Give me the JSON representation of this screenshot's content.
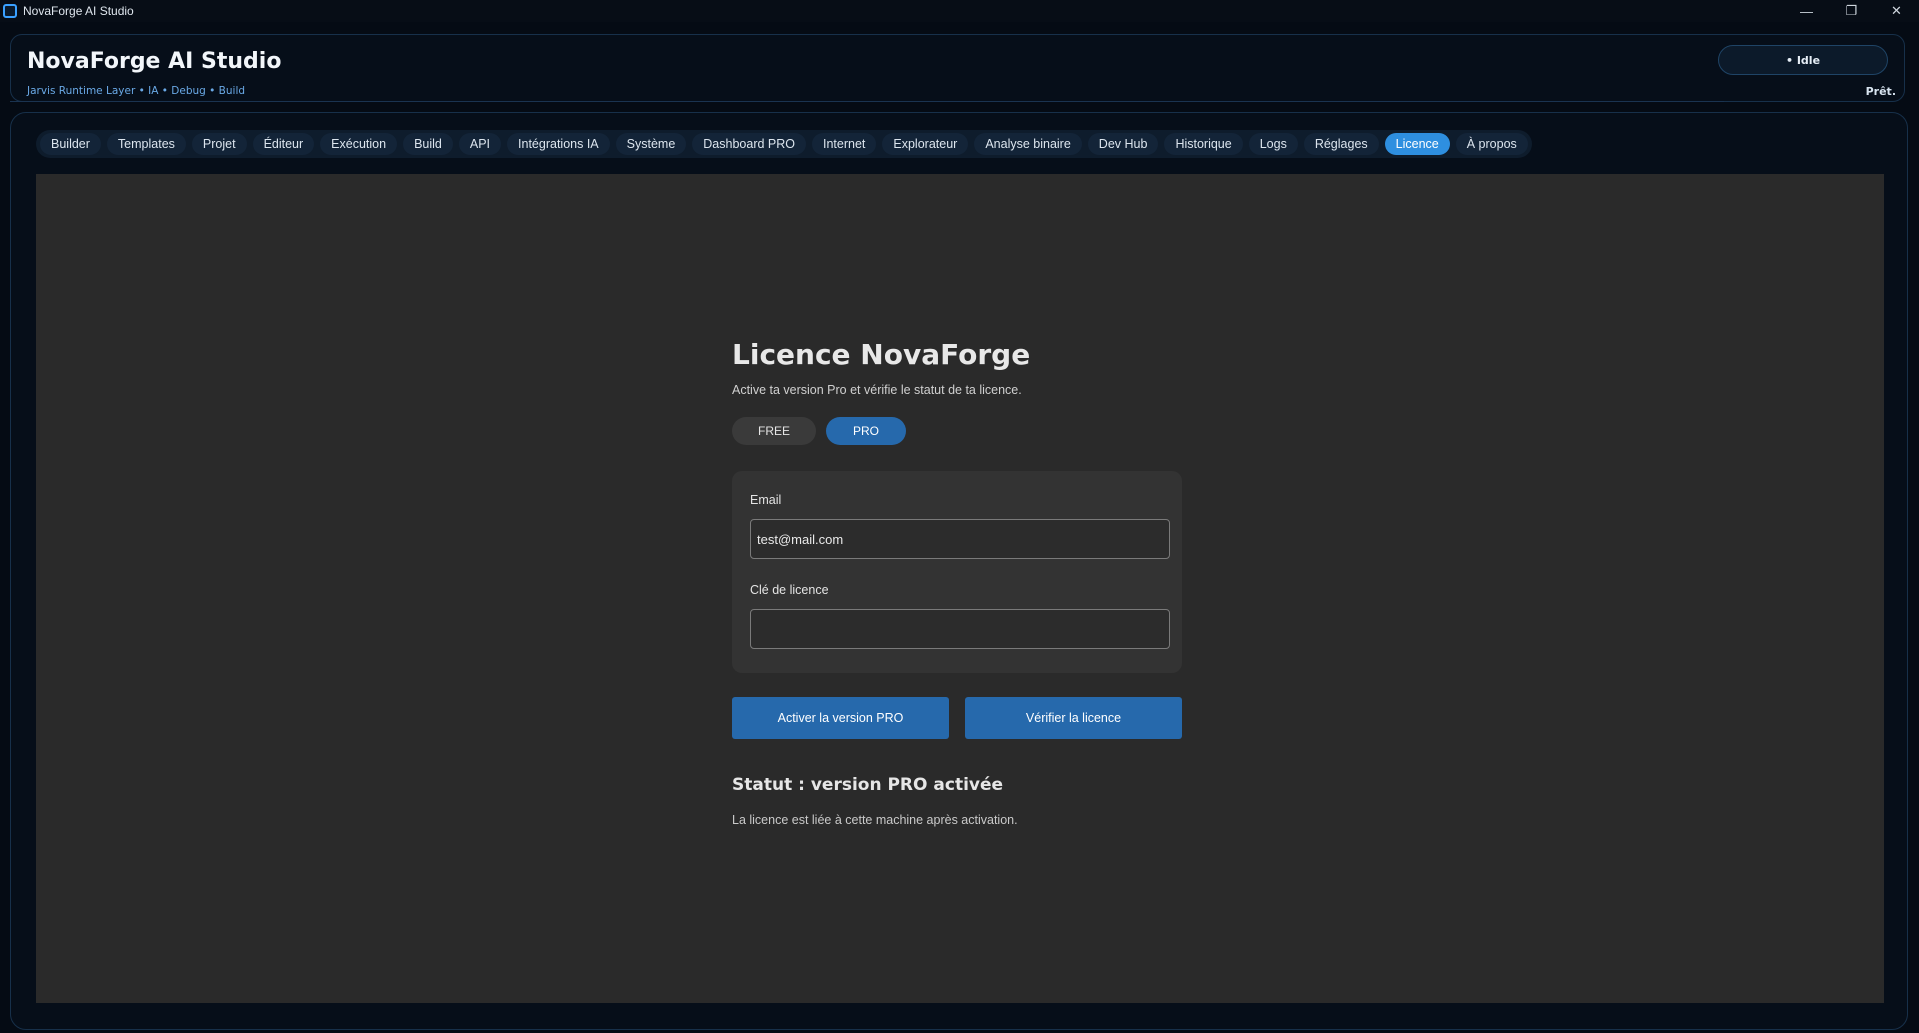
{
  "window": {
    "title": "NovaForge AI Studio",
    "controls": [
      "—",
      "❐",
      "✕"
    ]
  },
  "header": {
    "title": "NovaForge AI Studio",
    "subtitle": "Jarvis Runtime Layer • IA • Debug • Build",
    "status_pill": "• Idle",
    "ready_text": "Prêt."
  },
  "tabs": [
    {
      "label": "Builder",
      "active": false
    },
    {
      "label": "Templates",
      "active": false
    },
    {
      "label": "Projet",
      "active": false
    },
    {
      "label": "Éditeur",
      "active": false
    },
    {
      "label": "Exécution",
      "active": false
    },
    {
      "label": "Build",
      "active": false
    },
    {
      "label": "API",
      "active": false
    },
    {
      "label": "Intégrations IA",
      "active": false
    },
    {
      "label": "Système",
      "active": false
    },
    {
      "label": "Dashboard PRO",
      "active": false
    },
    {
      "label": "Internet",
      "active": false
    },
    {
      "label": "Explorateur",
      "active": false
    },
    {
      "label": "Analyse binaire",
      "active": false
    },
    {
      "label": "Dev Hub",
      "active": false
    },
    {
      "label": "Historique",
      "active": false
    },
    {
      "label": "Logs",
      "active": false
    },
    {
      "label": "Réglages",
      "active": false
    },
    {
      "label": "Licence",
      "active": true
    },
    {
      "label": "À propos",
      "active": false
    }
  ],
  "licence": {
    "title": "Licence NovaForge",
    "description": "Active ta version Pro et vérifie le statut de ta licence.",
    "plan_free": "FREE",
    "plan_pro": "PRO",
    "selected_plan": "PRO",
    "email_label": "Email",
    "email_value": "test@mail.com",
    "key_label": "Clé de licence",
    "key_value": "",
    "activate_button": "Activer la version PRO",
    "verify_button": "Vérifier la licence",
    "status": "Statut : version PRO activée",
    "status_note": "La licence est liée à cette machine après activation."
  },
  "colors": {
    "accent": "#2e8fe0",
    "button": "#2669ac",
    "background": "#050b14",
    "content": "#2a2a2a"
  }
}
